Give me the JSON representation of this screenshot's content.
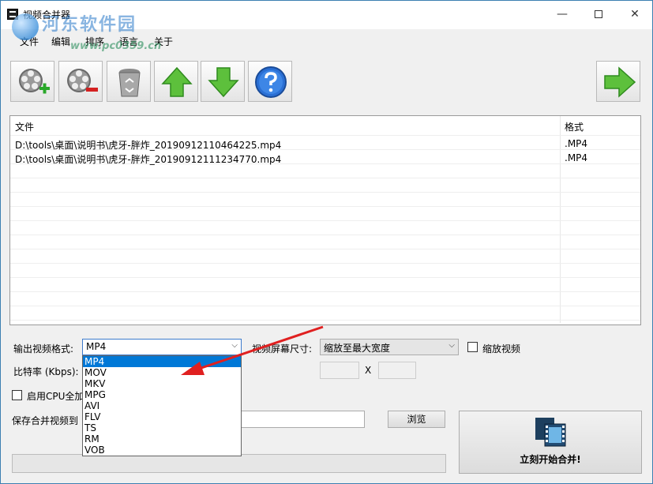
{
  "window": {
    "title": "视频合并器",
    "controls": {
      "minimize": "—",
      "close": "✕"
    }
  },
  "watermark": {
    "title": "河东软件园",
    "url": "www.pc0359.cn"
  },
  "menu": [
    "文件",
    "编辑",
    "排序",
    "语言",
    "关于"
  ],
  "toolbar": {
    "buttons": [
      {
        "icon": "add-video-icon"
      },
      {
        "icon": "remove-video-icon"
      },
      {
        "icon": "recycle-bin-icon"
      },
      {
        "icon": "move-up-icon"
      },
      {
        "icon": "move-down-icon"
      },
      {
        "icon": "help-icon"
      },
      {
        "icon": "next-arrow-icon"
      }
    ]
  },
  "file_list": {
    "columns": [
      "文件",
      "格式"
    ],
    "rows": [
      {
        "file": "D:\\tools\\桌面\\说明书\\虎牙-胖炸_20190912110464225.mp4",
        "format": ".MP4"
      },
      {
        "file": "D:\\tools\\桌面\\说明书\\虎牙-胖炸_20190912111234770.mp4",
        "format": ".MP4"
      }
    ]
  },
  "settings": {
    "output_format_label": "输出视频格式:",
    "output_format_value": "MP4",
    "output_format_options": [
      "MP4",
      "MOV",
      "MKV",
      "MPG",
      "AVI",
      "FLV",
      "TS",
      "RM",
      "VOB"
    ],
    "bitrate_label": "比特率 (Kbps):",
    "screen_size_label": "视频屏幕尺寸:",
    "screen_size_value": "缩放至最大宽度",
    "scale_video_label": "缩放视频",
    "x_label": "X",
    "cpu_label": "启用CPU全加",
    "save_label": "保存合并视频到",
    "browse_label": "浏览",
    "start_label": "立刻开始合并!"
  },
  "progress": 0,
  "colors": {
    "selection": "#0078d7",
    "annotation_arrow": "#e02020"
  }
}
